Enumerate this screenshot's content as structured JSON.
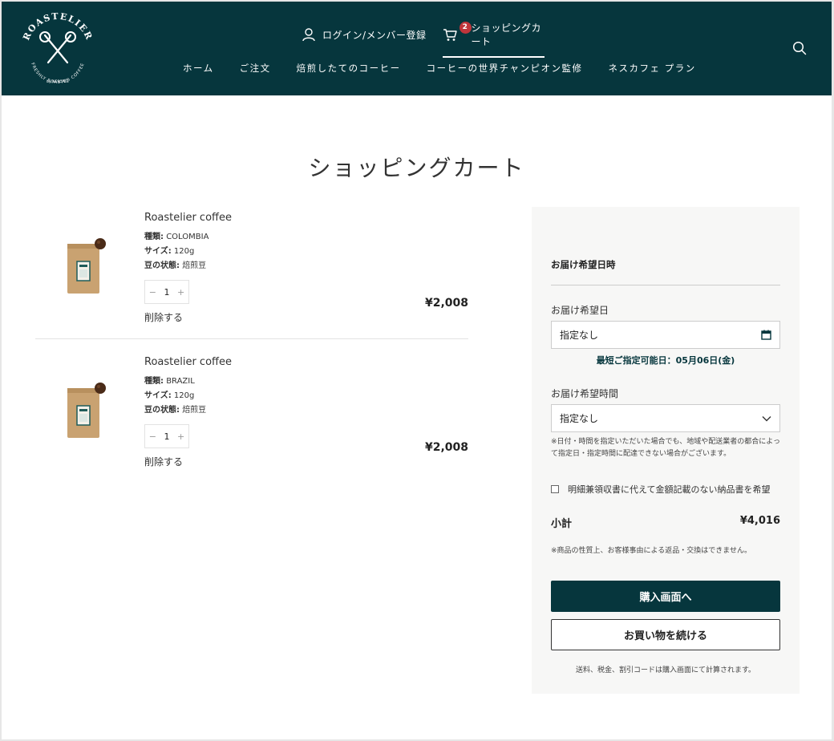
{
  "brand": {
    "logo_text_top": "ROASTELIER",
    "logo_text_bottom": "FRESHLY ROASTED COFFEE",
    "logo_by": "by NESCAFÉ"
  },
  "header": {
    "login_label": "ログイン/メンバー登録",
    "cart_label": "ショッピングカート",
    "cart_count": "2",
    "nav": [
      "ホーム",
      "ご注文",
      "焙煎したてのコーヒー",
      "コーヒーの世界チャンピオン監修",
      "ネスカフェ プラン"
    ]
  },
  "page": {
    "title": "ショッピングカート"
  },
  "cart": {
    "items": [
      {
        "name": "Roastelier coffee",
        "attrs": [
          {
            "key": "種類:",
            "value": "COLOMBIA"
          },
          {
            "key": "サイズ:",
            "value": "120g"
          },
          {
            "key": "豆の状態:",
            "value": "焙煎豆"
          }
        ],
        "qty_minus": "−",
        "qty": "1",
        "qty_plus": "+",
        "remove_label": "削除する",
        "price": "¥2,008"
      },
      {
        "name": "Roastelier coffee",
        "attrs": [
          {
            "key": "種類:",
            "value": "BRAZIL"
          },
          {
            "key": "サイズ:",
            "value": "120g"
          },
          {
            "key": "豆の状態:",
            "value": "焙煎豆"
          }
        ],
        "qty_minus": "−",
        "qty": "1",
        "qty_plus": "+",
        "remove_label": "削除する",
        "price": "¥2,008"
      }
    ]
  },
  "sidebar": {
    "delivery_heading": "お届け希望日時",
    "date_label": "お届け希望日",
    "date_value": "指定なし",
    "earliest_text": "最短ご指定可能日：05月06日(金)",
    "time_label": "お届け希望時間",
    "time_value": "指定なし",
    "delivery_note": "※日付・時間を指定いただいた場合でも、地域や配送業者の都合によって指定日・指定時間に配達できない場合がございます。",
    "receipt_option": "明細兼領収書に代えて金額記載のない納品書を希望",
    "subtotal_label": "小計",
    "subtotal_value": "¥4,016",
    "return_note": "※商品の性質上、お客様事由による返品・交換はできません。",
    "checkout_button": "購入画面へ",
    "continue_button": "お買い物を続ける",
    "footnote": "送料、税金、割引コードは購入画面にて計算されます。"
  },
  "colors": {
    "brand_dark": "#06363d",
    "badge": "#c0353b"
  }
}
